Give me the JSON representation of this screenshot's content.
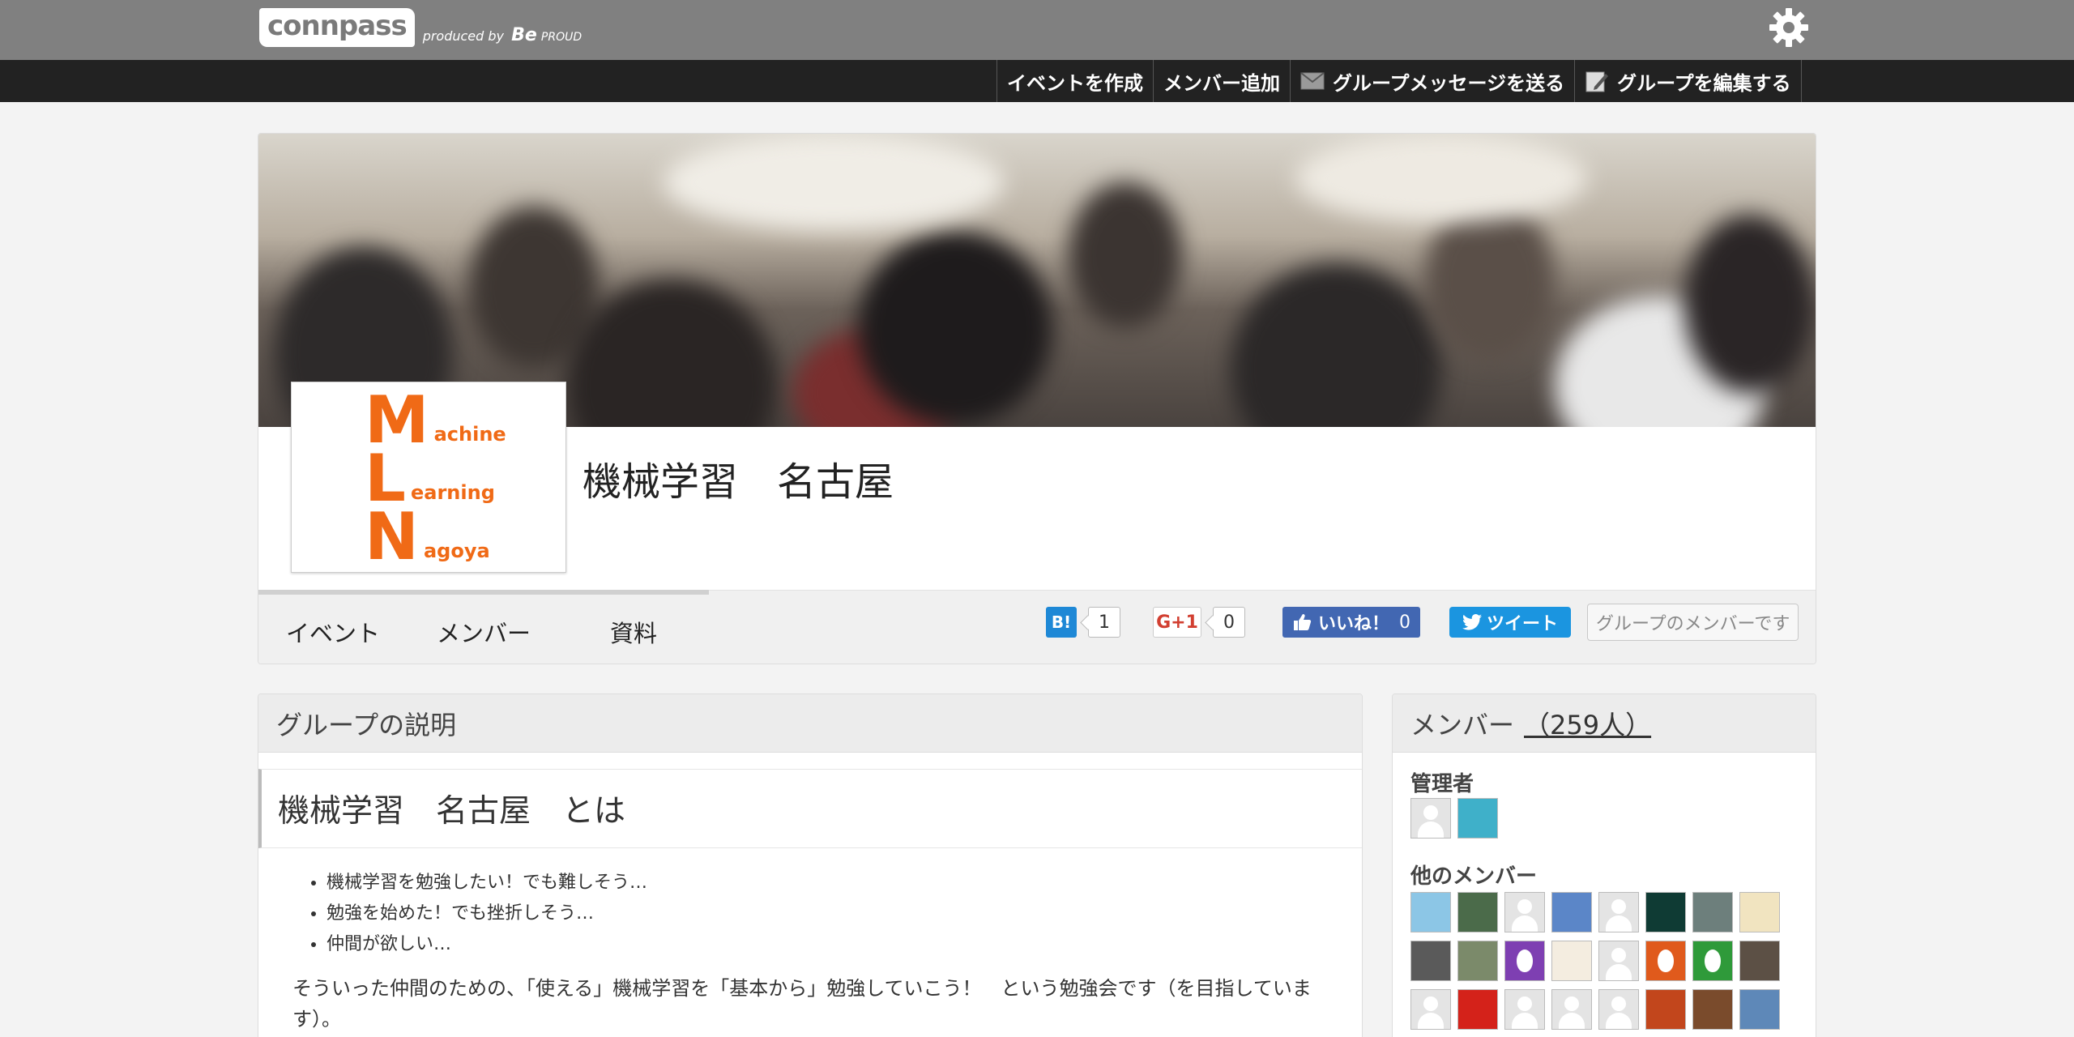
{
  "brand": {
    "name": "connpass",
    "produced_by": "produced by",
    "producer": "Be",
    "producer_suffix": "PROUD"
  },
  "actions": [
    {
      "label": "イベントを作成",
      "icon": ""
    },
    {
      "label": "メンバー追加",
      "icon": ""
    },
    {
      "label": "グループメッセージを送る",
      "icon": "envelope-icon"
    },
    {
      "label": "グループを編集する",
      "icon": "pencil-icon"
    }
  ],
  "group": {
    "title": "機械学習　名古屋",
    "logo": {
      "line1_big": "M",
      "line1_small": "achine",
      "line2_big": "L",
      "line2_small": "earning",
      "line3_big": "N",
      "line3_small": "agoya",
      "color": "#f06a16"
    }
  },
  "tabs": [
    "イベント",
    "メンバー",
    "資料"
  ],
  "social": {
    "hatena_label": "B!",
    "hatena_count": "1",
    "gplus_label": "G+1",
    "gplus_count": "0",
    "like_label": "いいね！",
    "like_count": "0",
    "tweet_label": "ツイート",
    "membership_label": "グループのメンバーです"
  },
  "description": {
    "panel_title": "グループの説明",
    "heading": "機械学習　名古屋　とは",
    "bullets": [
      "機械学習を勉強したい！でも難しそう…",
      "勉強を始めた！でも挫折しそう…",
      "仲間が欲しい…"
    ],
    "paragraph": "そういった仲間のための、「使える」機械学習を「基本から」勉強していこう！　という勉強会です（を目指しています）。"
  },
  "members": {
    "panel_title": "メンバー",
    "count_label": "（259人）",
    "admins_label": "管理者",
    "others_label": "他のメンバー",
    "admins": [
      {
        "kind": "default",
        "color": "#e4e4e4"
      },
      {
        "kind": "photo",
        "color": "#3fb0c9"
      }
    ],
    "others": [
      {
        "kind": "photo",
        "color": "#8cc6e6"
      },
      {
        "kind": "photo",
        "color": "#4b6b4a"
      },
      {
        "kind": "default",
        "color": "#e4e4e4"
      },
      {
        "kind": "photo",
        "color": "#5b86c8"
      },
      {
        "kind": "default",
        "color": "#e4e4e4"
      },
      {
        "kind": "photo",
        "color": "#0f3b34"
      },
      {
        "kind": "photo",
        "color": "#6d7f7c"
      },
      {
        "kind": "photo",
        "color": "#f1e4c0"
      },
      {
        "kind": "photo",
        "color": "#5a5a5a"
      },
      {
        "kind": "photo",
        "color": "#7b8a6a"
      },
      {
        "kind": "egg",
        "color": "#7e3fb2"
      },
      {
        "kind": "photo",
        "color": "#f4ede0"
      },
      {
        "kind": "default",
        "color": "#e4e4e4"
      },
      {
        "kind": "egg",
        "color": "#e05a1c"
      },
      {
        "kind": "egg",
        "color": "#2f9a3a"
      },
      {
        "kind": "photo",
        "color": "#5c5045"
      },
      {
        "kind": "default",
        "color": "#e4e4e4"
      },
      {
        "kind": "photo",
        "color": "#d4221a"
      },
      {
        "kind": "default",
        "color": "#e4e4e4"
      },
      {
        "kind": "default",
        "color": "#e4e4e4"
      },
      {
        "kind": "default",
        "color": "#e4e4e4"
      },
      {
        "kind": "photo",
        "color": "#c2461c"
      },
      {
        "kind": "photo",
        "color": "#7a4b2c"
      },
      {
        "kind": "photo",
        "color": "#5e88b8"
      }
    ]
  }
}
